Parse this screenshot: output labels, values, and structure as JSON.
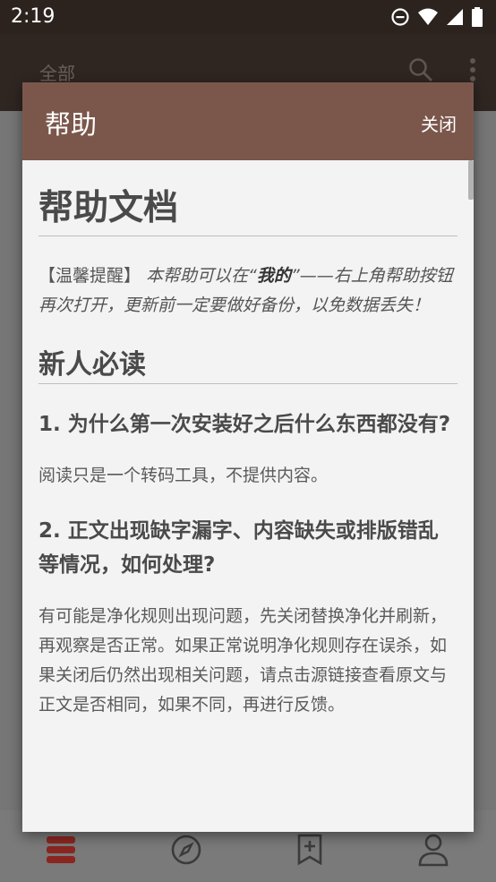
{
  "status_bar": {
    "time": "2:19"
  },
  "app_bar": {
    "title": "全部"
  },
  "dialog": {
    "title": "帮助",
    "close_label": "关闭",
    "doc": {
      "h1": "帮助文档",
      "notice": {
        "tag": "【温馨提醒】",
        "text_before": " 本帮助可以在“",
        "bold": "我的",
        "text_after": "”——右上角帮助按钮再次打开，更新前一定要做好备份，以免数据丢失！"
      },
      "section_title": "新人必读",
      "q1": "1. 为什么第一次安装好之后什么东西都没有?",
      "a1": "阅读只是一个转码工具，不提供内容。",
      "q2": "2. 正文出现缺字漏字、内容缺失或排版错乱等情况，如何处理?",
      "a2": "有可能是净化规则出现问题，先关闭替换净化并刷新，再观察是否正常。如果正常说明净化规则存在误杀，如果关闭后仍然出现相关问题，请点击源链接查看原文与正文是否相同，如果不同，再进行反馈。"
    }
  },
  "colors": {
    "dialog_header": "#7b574b",
    "app_bar": "#2f2622",
    "accent": "#b3322a"
  },
  "icons": [
    "minus-circle-icon",
    "wifi-icon",
    "signal-icon",
    "battery-icon",
    "search-icon",
    "more-vert-icon",
    "bookshelf-icon",
    "compass-icon",
    "bookmark-add-icon",
    "person-icon"
  ]
}
